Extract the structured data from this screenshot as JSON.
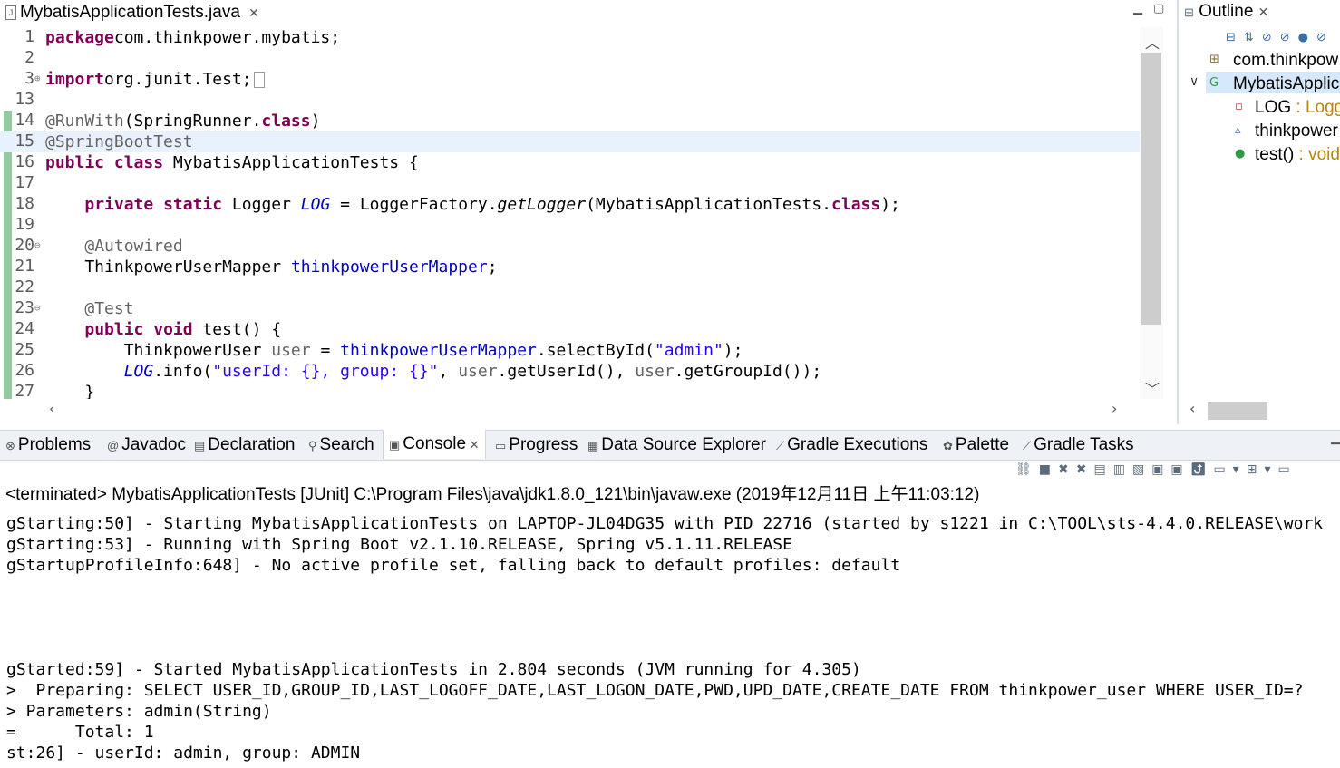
{
  "editor": {
    "tab_label": "MybatisApplicationTests.java",
    "tab_close": "✕",
    "lines": [
      {
        "num": "1",
        "fold": "",
        "segs": [
          [
            "kw",
            "package"
          ],
          [
            "",
            "com.thinkpower.mybatis;"
          ]
        ]
      },
      {
        "num": "2",
        "fold": "",
        "segs": []
      },
      {
        "num": "3",
        "fold": "⊕",
        "segs": [
          [
            "kw",
            "import"
          ],
          [
            "",
            "org.junit.Test;"
          ]
        ]
      },
      {
        "num": "13",
        "fold": "",
        "segs": []
      },
      {
        "num": "14",
        "fold": "",
        "segs": [
          [
            "an",
            "@RunWith"
          ],
          [
            "",
            "(SpringRunner."
          ],
          [
            "kw",
            "class"
          ],
          [
            "",
            ")"
          ]
        ]
      },
      {
        "num": "15",
        "fold": "",
        "segs": [
          [
            "an",
            "@SpringBootTest"
          ]
        ]
      },
      {
        "num": "16",
        "fold": "",
        "segs": [
          [
            "kw",
            "public"
          ],
          [
            "",
            " "
          ],
          [
            "kw",
            "class"
          ],
          [
            "",
            " MybatisApplicationTests {"
          ]
        ]
      },
      {
        "num": "17",
        "fold": "",
        "segs": []
      },
      {
        "num": "18",
        "fold": "",
        "segs": [
          [
            "",
            "    "
          ],
          [
            "kw",
            "private"
          ],
          [
            "",
            " "
          ],
          [
            "kw",
            "static"
          ],
          [
            "",
            " Logger "
          ],
          [
            "sfi",
            "LOG"
          ],
          [
            "",
            " = LoggerFactory."
          ],
          [
            "it",
            "getLogger"
          ],
          [
            "",
            "(MybatisApplicationTests."
          ],
          [
            "kw",
            "class"
          ],
          [
            "",
            ");"
          ]
        ]
      },
      {
        "num": "19",
        "fold": "",
        "segs": []
      },
      {
        "num": "20",
        "fold": "⊖",
        "segs": [
          [
            "",
            "    "
          ],
          [
            "an",
            "@Autowired"
          ]
        ]
      },
      {
        "num": "21",
        "fold": "",
        "segs": [
          [
            "",
            "    ThinkpowerUserMapper "
          ],
          [
            "fi",
            "thinkpowerUserMapper"
          ],
          [
            "",
            ";"
          ]
        ]
      },
      {
        "num": "22",
        "fold": "",
        "segs": []
      },
      {
        "num": "23",
        "fold": "⊖",
        "segs": [
          [
            "",
            "    "
          ],
          [
            "an",
            "@Test"
          ]
        ]
      },
      {
        "num": "24",
        "fold": "",
        "segs": [
          [
            "",
            "    "
          ],
          [
            "kw",
            "public"
          ],
          [
            "",
            " "
          ],
          [
            "kw",
            "void"
          ],
          [
            "",
            " test() {"
          ]
        ]
      },
      {
        "num": "25",
        "fold": "",
        "segs": [
          [
            "",
            "        ThinkpowerUser "
          ],
          [
            "an",
            "user"
          ],
          [
            "",
            " = "
          ],
          [
            "fi",
            "thinkpowerUserMapper"
          ],
          [
            "",
            ".selectById("
          ],
          [
            "st",
            "\"admin\""
          ],
          [
            "",
            ");"
          ]
        ]
      },
      {
        "num": "26",
        "fold": "",
        "segs": [
          [
            "",
            "        "
          ],
          [
            "sfi",
            "LOG"
          ],
          [
            "",
            ".info("
          ],
          [
            "st",
            "\"userId: {}, group: {}\""
          ],
          [
            "",
            ", "
          ],
          [
            "an",
            "user"
          ],
          [
            "",
            ".getUserId(), "
          ],
          [
            "an",
            "user"
          ],
          [
            "",
            ".getGroupId());"
          ]
        ]
      },
      {
        "num": "27",
        "fold": "",
        "segs": [
          [
            "",
            "    }"
          ]
        ]
      }
    ]
  },
  "outline": {
    "title": "Outline",
    "items": [
      {
        "icon": "package-icon",
        "glyph": "⊞",
        "label": "com.thinkpow",
        "type": ""
      },
      {
        "icon": "class-icon",
        "glyph": "G",
        "label": "MybatisApplic",
        "type": ""
      },
      {
        "icon": "private-field-icon",
        "glyph": "▫",
        "label": "LOG",
        "type": " : Logg"
      },
      {
        "icon": "default-field-icon",
        "glyph": "▵",
        "label": "thinkpower",
        "type": ""
      },
      {
        "icon": "public-method-icon",
        "glyph": "●",
        "label": "test()",
        "type": " : void"
      }
    ]
  },
  "bottom_tabs": [
    {
      "name": "problems",
      "icon": "⊗",
      "label": "Problems"
    },
    {
      "name": "javadoc",
      "icon": "@",
      "label": "Javadoc"
    },
    {
      "name": "declaration",
      "icon": "▤",
      "label": "Declaration"
    },
    {
      "name": "search",
      "icon": "⚲",
      "label": "Search"
    },
    {
      "name": "console",
      "icon": "▣",
      "label": "Console"
    },
    {
      "name": "progress",
      "icon": "▭",
      "label": "Progress"
    },
    {
      "name": "data-source-explorer",
      "icon": "▦",
      "label": "Data Source Explorer"
    },
    {
      "name": "gradle-executions",
      "icon": "⟋",
      "label": "Gradle Executions"
    },
    {
      "name": "palette",
      "icon": "✿",
      "label": "Palette"
    },
    {
      "name": "gradle-tasks",
      "icon": "⟋",
      "label": "Gradle Tasks"
    }
  ],
  "console": {
    "close": "✕",
    "header": "<terminated> MybatisApplicationTests [JUnit] C:\\Program Files\\java\\jdk1.8.0_121\\bin\\javaw.exe (2019年12月11日 上午11:03:12)",
    "lines": [
      "gStarting:50] - Starting MybatisApplicationTests on LAPTOP-JL04DG35 with PID 22716 (started by s1221 in C:\\TOOL\\sts-4.4.0.RELEASE\\work",
      "gStarting:53] - Running with Spring Boot v2.1.10.RELEASE, Spring v5.1.11.RELEASE",
      "gStartupProfileInfo:648] - No active profile set, falling back to default profiles: default",
      "",
      "",
      "",
      "",
      "gStarted:59] - Started MybatisApplicationTests in 2.804 seconds (JVM running for 4.305)",
      ">  Preparing: SELECT USER_ID,GROUP_ID,LAST_LOGOFF_DATE,LAST_LOGON_DATE,PWD,UPD_DATE,CREATE_DATE FROM thinkpower_user WHERE USER_ID=?",
      "> Parameters: admin(String)",
      "=      Total: 1",
      "st:26] - userId: admin, group: ADMIN"
    ]
  }
}
